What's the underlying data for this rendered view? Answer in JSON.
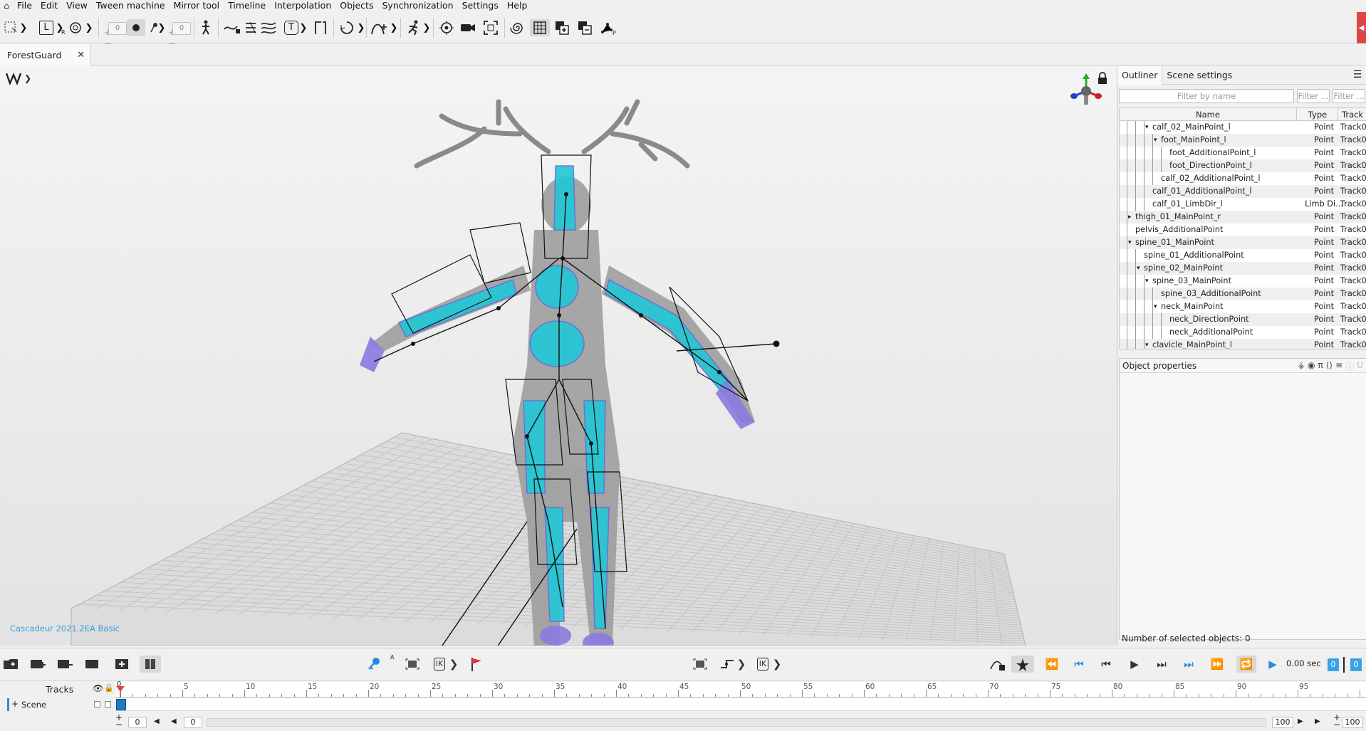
{
  "menu": [
    "File",
    "Edit",
    "View",
    "Tween machine",
    "Mirror tool",
    "Timeline",
    "Interpolation",
    "Objects",
    "Synchronization",
    "Settings",
    "Help"
  ],
  "toolbar": {
    "num1": "0",
    "num2": "0",
    "select_mode_label": "L",
    "text_tool_label": "T",
    "r_badge": "R",
    "a_badge": "A"
  },
  "document": {
    "tab_title": "ForestGuard",
    "close_glyph": "✕"
  },
  "viewport": {
    "watermark": "Cascadeur 2021.2EA Basic"
  },
  "rightpanel": {
    "tabs": [
      "Outliner",
      "Scene settings"
    ],
    "filters": {
      "name": "Filter by name",
      "type": "Filter ...",
      "track": "Filter ..."
    },
    "columns": {
      "name": "Name",
      "type": "Type",
      "track": "Track"
    },
    "rows": [
      {
        "name": "calf_02_MainPoint_l",
        "depth": 3,
        "expand": "▾",
        "type": "Point",
        "track": "Track0"
      },
      {
        "name": "foot_MainPoint_l",
        "depth": 4,
        "expand": "▾",
        "type": "Point",
        "track": "Track0"
      },
      {
        "name": "foot_AdditionalPoint_l",
        "depth": 5,
        "expand": "",
        "type": "Point",
        "track": "Track0"
      },
      {
        "name": "foot_DirectionPoint_l",
        "depth": 5,
        "expand": "",
        "type": "Point",
        "track": "Track0"
      },
      {
        "name": "calf_02_AdditionalPoint_l",
        "depth": 4,
        "expand": "",
        "type": "Point",
        "track": "Track0"
      },
      {
        "name": "calf_01_AdditionalPoint_l",
        "depth": 3,
        "expand": "",
        "type": "Point",
        "track": "Track0"
      },
      {
        "name": "calf_01_LimbDir_l",
        "depth": 3,
        "expand": "",
        "type": "Limb Di...",
        "track": "Track0"
      },
      {
        "name": "thigh_01_MainPoint_r",
        "depth": 1,
        "expand": "▸",
        "type": "Point",
        "track": "Track0"
      },
      {
        "name": "pelvis_AdditionalPoint",
        "depth": 1,
        "expand": "",
        "type": "Point",
        "track": "Track0"
      },
      {
        "name": "spine_01_MainPoint",
        "depth": 1,
        "expand": "▾",
        "type": "Point",
        "track": "Track0"
      },
      {
        "name": "spine_01_AdditionalPoint",
        "depth": 2,
        "expand": "",
        "type": "Point",
        "track": "Track0"
      },
      {
        "name": "spine_02_MainPoint",
        "depth": 2,
        "expand": "▾",
        "type": "Point",
        "track": "Track0"
      },
      {
        "name": "spine_03_MainPoint",
        "depth": 3,
        "expand": "▾",
        "type": "Point",
        "track": "Track0"
      },
      {
        "name": "spine_03_AdditionalPoint",
        "depth": 4,
        "expand": "",
        "type": "Point",
        "track": "Track0"
      },
      {
        "name": "neck_MainPoint",
        "depth": 4,
        "expand": "▾",
        "type": "Point",
        "track": "Track0"
      },
      {
        "name": "neck_DirectionPoint",
        "depth": 5,
        "expand": "",
        "type": "Point",
        "track": "Track0"
      },
      {
        "name": "neck_AdditionalPoint",
        "depth": 5,
        "expand": "",
        "type": "Point",
        "track": "Track0"
      },
      {
        "name": "clavicle_MainPoint_l",
        "depth": 3,
        "expand": "▾",
        "type": "Point",
        "track": "Track0"
      }
    ],
    "object_properties_title": "Object properties",
    "selected_count": "Number of selected objects: 0"
  },
  "playback": {
    "time": "0.00 sec",
    "frame_a": "0",
    "frame_b": "0"
  },
  "timeline": {
    "tracks_label": "Tracks",
    "scene_label": "Scene",
    "ticks": [
      "5",
      "10",
      "15",
      "20",
      "25",
      "30",
      "35",
      "40",
      "45",
      "50",
      "55",
      "60",
      "65",
      "70",
      "75",
      "80",
      "85",
      "90",
      "95"
    ],
    "start_frame": "0",
    "current_frame_left": "0",
    "current_frame_right": "0",
    "end_frame": "100",
    "end_frame_right": "100",
    "playhead_label": "0"
  },
  "colors": {
    "accent": "#3aa1e6",
    "record_red": "#e04545",
    "watermark": "#3a9fd8"
  }
}
